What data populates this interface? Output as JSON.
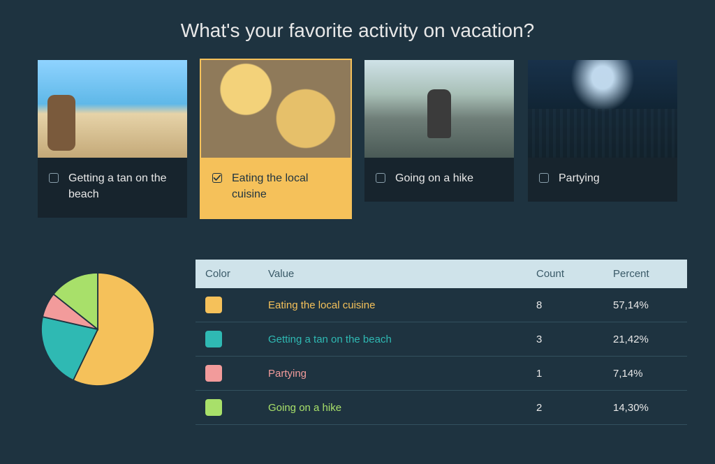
{
  "question": "What's your favorite activity on vacation?",
  "options": [
    {
      "label": "Getting a tan on the beach",
      "imgClass": "img-beach",
      "selected": false
    },
    {
      "label": "Eating the local cuisine",
      "imgClass": "img-food",
      "selected": true
    },
    {
      "label": "Going on a hike",
      "imgClass": "img-hike",
      "selected": false
    },
    {
      "label": "Partying",
      "imgClass": "img-party",
      "selected": false
    }
  ],
  "table": {
    "headers": {
      "color": "Color",
      "value": "Value",
      "count": "Count",
      "percent": "Percent"
    },
    "rows": [
      {
        "color": "#f5c15a",
        "value": "Eating the local cuisine",
        "count": "8",
        "percent": "57,14%",
        "pct": 57.14
      },
      {
        "color": "#2fb9b3",
        "value": "Getting a tan on the beach",
        "count": "3",
        "percent": "21,42%",
        "pct": 21.42
      },
      {
        "color": "#f29b9b",
        "value": "Partying",
        "count": "1",
        "percent": "7,14%",
        "pct": 7.14
      },
      {
        "color": "#a8e06a",
        "value": "Going on a hike",
        "count": "2",
        "percent": "14,30%",
        "pct": 14.3
      }
    ]
  },
  "chart_data": {
    "type": "pie",
    "title": "What's your favorite activity on vacation?",
    "series": [
      {
        "name": "Eating the local cuisine",
        "value": 8,
        "color": "#f5c15a",
        "percent": 57.14
      },
      {
        "name": "Getting a tan on the beach",
        "value": 3,
        "color": "#2fb9b3",
        "percent": 21.42
      },
      {
        "name": "Partying",
        "value": 1,
        "color": "#f29b9b",
        "percent": 7.14
      },
      {
        "name": "Going on a hike",
        "value": 2,
        "color": "#a8e06a",
        "percent": 14.3
      }
    ]
  }
}
